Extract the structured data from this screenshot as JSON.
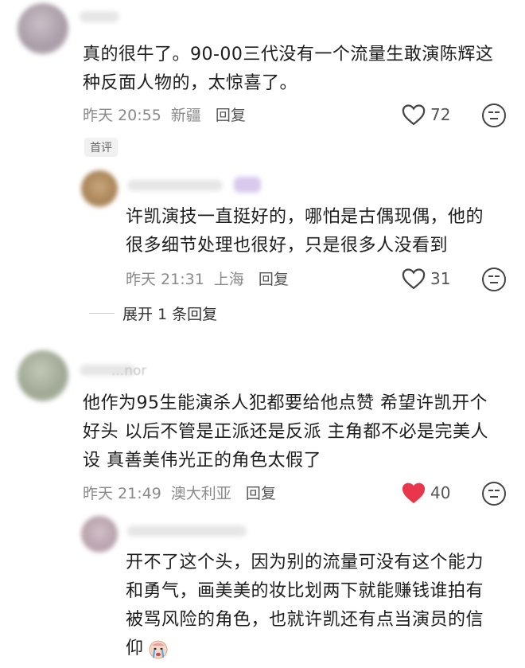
{
  "comments": [
    {
      "username": "",
      "text_line1": "真的很牛了。90-00三代没有一个流量生敢演陈辉这",
      "text_line2": "种反面人物的，太惊喜了。",
      "time": "昨天 20:55",
      "location": "新疆",
      "reply_label": "回复",
      "likes": "72",
      "liked": false,
      "badge": "首评"
    },
    {
      "username": "",
      "text_line1": "许凯演技一直挺好的，哪怕是古偶现偶，他的",
      "text_line2": "很多细节处理也很好，只是很多人没看到",
      "time": "昨天 21:31",
      "location": "上海",
      "reply_label": "回复",
      "likes": "31",
      "liked": false,
      "expand_label": "展开 1 条回复"
    },
    {
      "username": "...nor",
      "text_line1": "他作为95生能演杀人犯都要给他点赞 希望许凯开个",
      "text_line2": "好头 以后不管是正派还是反派 主角都不必是完美人",
      "text_line3": "设 真善美伟光正的角色太假了",
      "time": "昨天 21:49",
      "location": "澳大利亚",
      "reply_label": "回复",
      "likes": "40",
      "liked": true
    },
    {
      "username": "",
      "text_line1": "开不了这个头，因为别的流量可没有这个能力",
      "text_line2": "和勇气，画美美的妆比划两下就能赚钱谁拍有",
      "text_line3": "被骂风险的角色，也就许凯还有点当演员的信",
      "text_line4": "仰",
      "trailing_emoji": "crying-face-emoji"
    }
  ],
  "colors": {
    "liked_heart": "#e8374a",
    "meta_gray": "#8a8a8a"
  }
}
